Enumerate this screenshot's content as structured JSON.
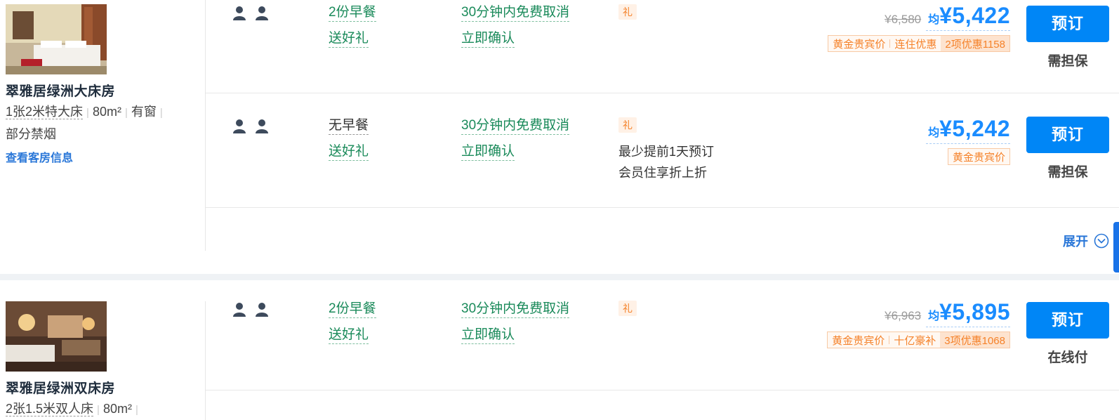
{
  "rooms": [
    {
      "name": "翠雅居绿洲大床房",
      "bed": "1张2米特大床",
      "area": "80m²",
      "window": "有窗",
      "smoking": "部分禁烟",
      "link": "查看客房信息",
      "rates": [
        {
          "meal": [
            "2份早餐",
            "送好礼"
          ],
          "policy": [
            "30分钟内免费取消",
            "立即确认"
          ],
          "gift": "礼",
          "notes": [],
          "orig_price": "¥6,580",
          "avg_label": "均",
          "price": "¥5,422",
          "tags": [
            "黄金贵宾价",
            "连住优惠",
            "2项优惠1158"
          ],
          "book": "预订",
          "payment": "需担保"
        },
        {
          "meal": [
            "无早餐",
            "送好礼"
          ],
          "policy": [
            "30分钟内免费取消",
            "立即确认"
          ],
          "gift": "礼",
          "notes": [
            "最少提前1天预订",
            "会员住享折上折"
          ],
          "orig_price": "",
          "avg_label": "均",
          "price": "¥5,242",
          "tags": [
            "黄金贵宾价"
          ],
          "book": "预订",
          "payment": "需担保"
        }
      ],
      "expand": "展开"
    },
    {
      "name": "翠雅居绿洲双床房",
      "bed": "2张1.5米双人床",
      "area": "80m²",
      "rates": [
        {
          "meal": [
            "2份早餐",
            "送好礼"
          ],
          "policy": [
            "30分钟内免费取消",
            "立即确认"
          ],
          "gift": "礼",
          "orig_price": "¥6,963",
          "avg_label": "均",
          "price": "¥5,895",
          "tags": [
            "黄金贵宾价",
            "十亿豪补",
            "3项优惠1068"
          ],
          "book": "预订",
          "payment": "在线付"
        }
      ]
    }
  ],
  "icons": {
    "guest": "person-icon",
    "expand": "chevron-down-circle-icon"
  },
  "colors": {
    "price": "#1a8cff",
    "book_button": "#0086f6",
    "green_text": "#1a8a5a",
    "promo": "#f5822a"
  }
}
